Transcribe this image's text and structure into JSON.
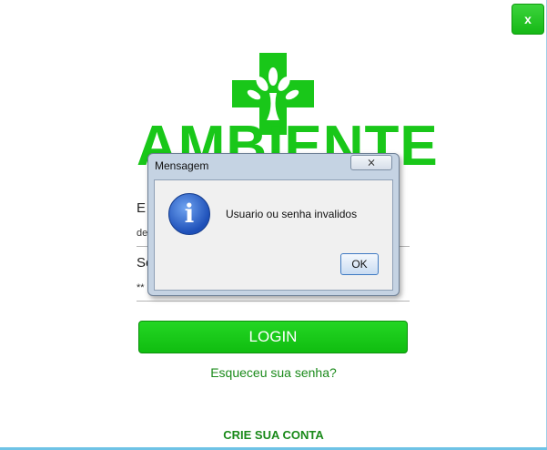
{
  "window": {
    "close_label": "x"
  },
  "logo": {
    "text": "AMBIENTE",
    "color": "#19c719"
  },
  "form": {
    "email_label_partial": "E",
    "email_value_partial": "de",
    "password_label_partial": "Se",
    "password_value_partial": "**",
    "login_label": "LOGIN",
    "forgot_label": "Esqueceu sua senha?",
    "create_account_label": "CRIE SUA CONTA"
  },
  "dialog": {
    "title": "Mensagem",
    "close_glyph": "⨯",
    "icon": "info-icon",
    "message": "Usuario ou senha invalidos",
    "ok_label": "OK"
  },
  "colors": {
    "accent": "#16b816",
    "link": "#1a8a1a"
  }
}
